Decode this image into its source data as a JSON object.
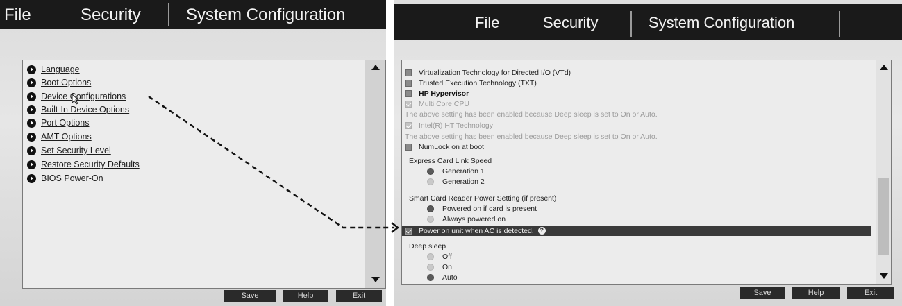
{
  "left": {
    "menu": {
      "file": "File",
      "security": "Security",
      "system_config": "System Configuration"
    },
    "options": [
      {
        "label": "Language"
      },
      {
        "label": "Boot Options"
      },
      {
        "label": "Device Configurations"
      },
      {
        "label": "Built-In Device Options"
      },
      {
        "label": "Port Options"
      },
      {
        "label": "AMT Options"
      },
      {
        "label": "Set Security Level"
      },
      {
        "label": "Restore Security Defaults"
      },
      {
        "label": "BIOS Power-On"
      }
    ],
    "buttons": {
      "save": "Save",
      "help": "Help",
      "exit": "Exit"
    }
  },
  "right": {
    "menu": {
      "file": "File",
      "security": "Security",
      "system_config": "System Configuration"
    },
    "settings": {
      "vtd": "Virtualization Technology for Directed I/O (VTd)",
      "txt": "Trusted Execution Technology (TXT)",
      "hp_hypervisor": "HP Hypervisor",
      "multi_core": "Multi Core CPU",
      "note1": "The above setting has been enabled because Deep sleep is set to On or Auto.",
      "ht": "Intel(R) HT Technology",
      "note2": "The above setting has been enabled because Deep sleep is set to On or Auto.",
      "numlock": "NumLock on at boot",
      "express_heading": "Express Card Link Speed",
      "gen1": "Generation 1",
      "gen2": "Generation 2",
      "smartcard_heading": "Smart Card Reader Power Setting (if present)",
      "powered_on": "Powered on if card is present",
      "always_on": "Always powered on",
      "power_on_ac": "Power on unit when AC is detected.",
      "deep_sleep_heading": "Deep sleep",
      "off": "Off",
      "on": "On",
      "auto": "Auto"
    },
    "buttons": {
      "save": "Save",
      "help": "Help",
      "exit": "Exit"
    }
  }
}
